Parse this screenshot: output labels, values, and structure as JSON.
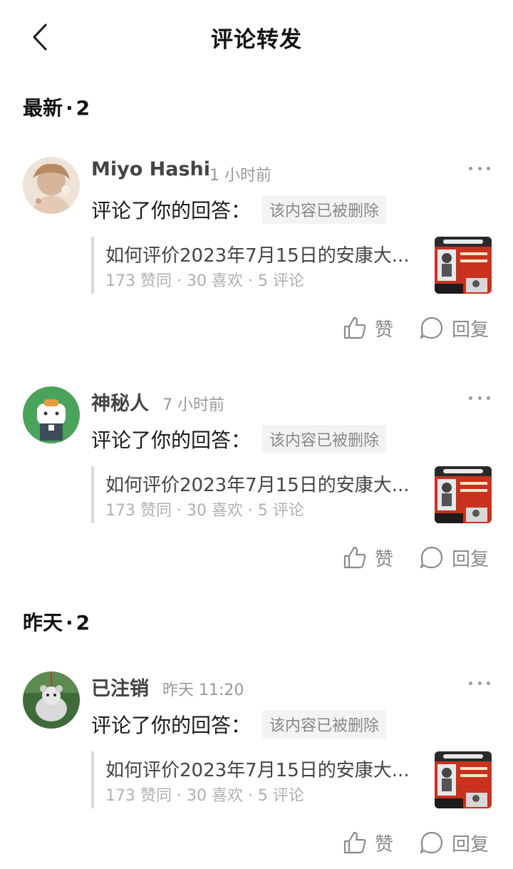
{
  "header": {
    "title": "评论转发"
  },
  "sections": [
    {
      "label": "最新",
      "separator": "·",
      "count": "2",
      "items": [
        {
          "username": "Miyo Hashi",
          "time": "1 小时前",
          "action": "评论了你的回答：",
          "deleted_tag": "该内容已被删除",
          "quote_title": "如何评价2023年7月15日的安康大...",
          "quote_meta": "173 赞同 · 30 喜欢 · 5 评论",
          "like_label": "赞",
          "reply_label": "回复"
        },
        {
          "username": "神秘人",
          "time": "7 小时前",
          "action": "评论了你的回答：",
          "deleted_tag": "该内容已被删除",
          "quote_title": "如何评价2023年7月15日的安康大...",
          "quote_meta": "173 赞同 · 30 喜欢 · 5 评论",
          "like_label": "赞",
          "reply_label": "回复"
        }
      ]
    },
    {
      "label": "昨天",
      "separator": "·",
      "count": "2",
      "items": [
        {
          "username": "已注销",
          "time": "昨天 11:20",
          "action": "评论了你的回答：",
          "deleted_tag": "该内容已被删除",
          "quote_title": "如何评价2023年7月15日的安康大...",
          "quote_meta": "173 赞同 · 30 喜欢 · 5 评论",
          "like_label": "赞",
          "reply_label": "回复"
        }
      ]
    }
  ],
  "icons": {
    "back": "chevron-left-icon",
    "more": "more-dots-icon",
    "like": "thumbs-up-icon",
    "reply": "chat-bubble-icon"
  },
  "colors": {
    "title": "#121212",
    "muted": "#999999",
    "tag_bg": "#f3f3f3",
    "quote_bar": "#dadada",
    "avatar2_bg": "#4aa35a",
    "thumb_red": "#c8321e"
  }
}
